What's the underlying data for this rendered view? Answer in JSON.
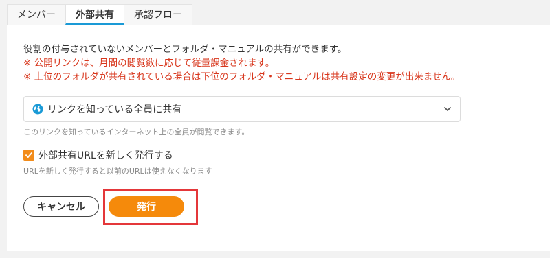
{
  "tabs": [
    {
      "label": "メンバー"
    },
    {
      "label": "外部共有"
    },
    {
      "label": "承認フロー"
    }
  ],
  "description": {
    "info": "役割の付与されていないメンバーとフォルダ・マニュアルの共有ができます。",
    "warn1": "※ 公開リンクは、月間の閲覧数に応じて従量課金されます。",
    "warn2": "※ 上位のフォルダが共有されている場合は下位のフォルダ・マニュアルは共有設定の変更が出来ません。"
  },
  "share_select": {
    "value": "リンクを知っている全員に共有",
    "hint": "このリンクを知っているインターネット上の全員が閲覧できます。"
  },
  "reissue": {
    "checked": true,
    "label": "外部共有URLを新しく発行する",
    "hint": "URLを新しく発行すると以前のURLは使えなくなります"
  },
  "buttons": {
    "cancel": "キャンセル",
    "issue": "発行"
  },
  "colors": {
    "accent": "#f58a0b",
    "warning": "#d8371d",
    "tab_underline": "#1a9ad6",
    "highlight_frame": "#e4373a"
  }
}
